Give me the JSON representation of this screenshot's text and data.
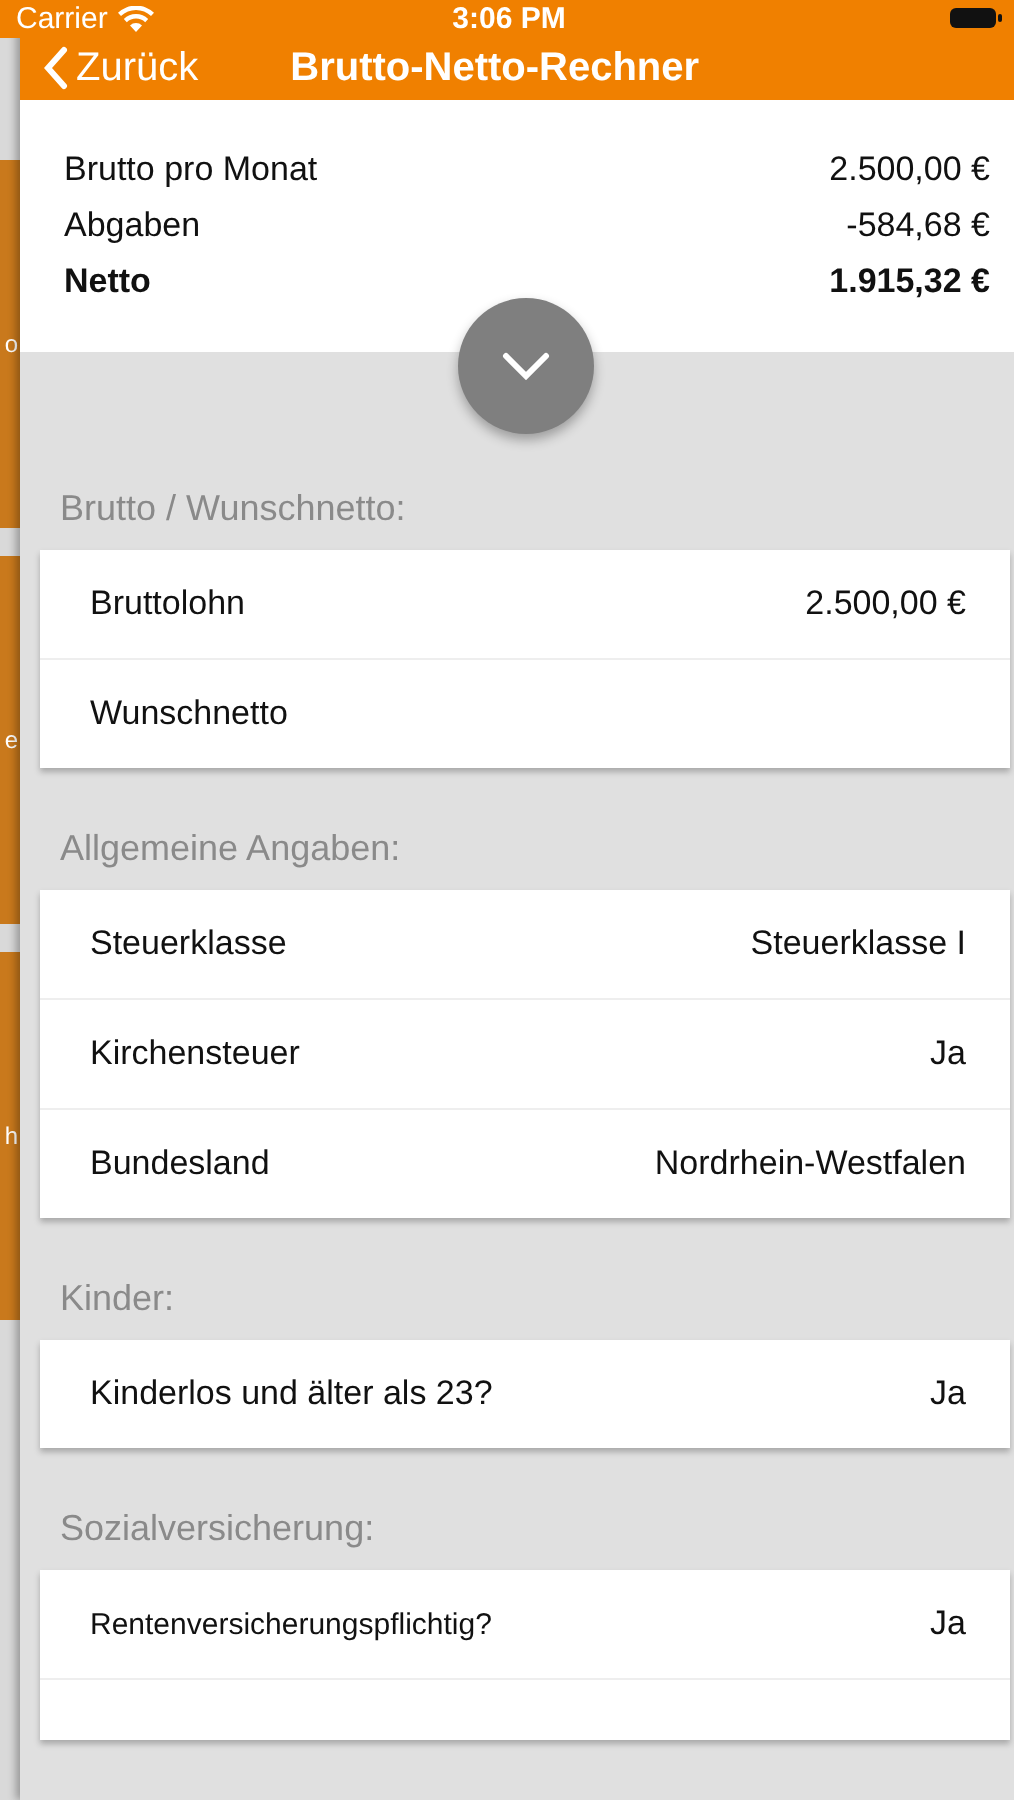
{
  "status_bar": {
    "carrier": "Carrier",
    "time": "3:06 PM"
  },
  "nav": {
    "back": "Zurück",
    "title": "Brutto-Netto-Rechner"
  },
  "behind_view": {
    "letters": [
      "o",
      "e",
      "h"
    ]
  },
  "summary": [
    {
      "label": "Brutto pro Monat",
      "value": "2.500,00 €",
      "emphasis": false
    },
    {
      "label": "Abgaben",
      "value": "-584,68 €",
      "emphasis": false
    },
    {
      "label": "Netto",
      "value": "1.915,32 €",
      "emphasis": true
    }
  ],
  "sections": [
    {
      "title": "Brutto / Wunschnetto:",
      "rows": [
        {
          "label": "Bruttolohn",
          "value": "2.500,00 €"
        },
        {
          "label": "Wunschnetto"
        }
      ]
    },
    {
      "title": "Allgemeine Angaben:",
      "rows": [
        {
          "label": "Steuerklasse",
          "value": "Steuerklasse I"
        },
        {
          "label": "Kirchensteuer",
          "value": "Ja"
        },
        {
          "label": "Bundesland",
          "value": "Nordrhein-Westfalen"
        }
      ]
    },
    {
      "title": "Kinder:",
      "rows": [
        {
          "label": "Kinderlos und älter als 23?",
          "value": "Ja"
        }
      ]
    },
    {
      "title": "Sozialversicherung:",
      "rows": [
        {
          "label": "Rentenversicherungspflichtig?",
          "value": "Ja",
          "small": true
        }
      ]
    }
  ]
}
